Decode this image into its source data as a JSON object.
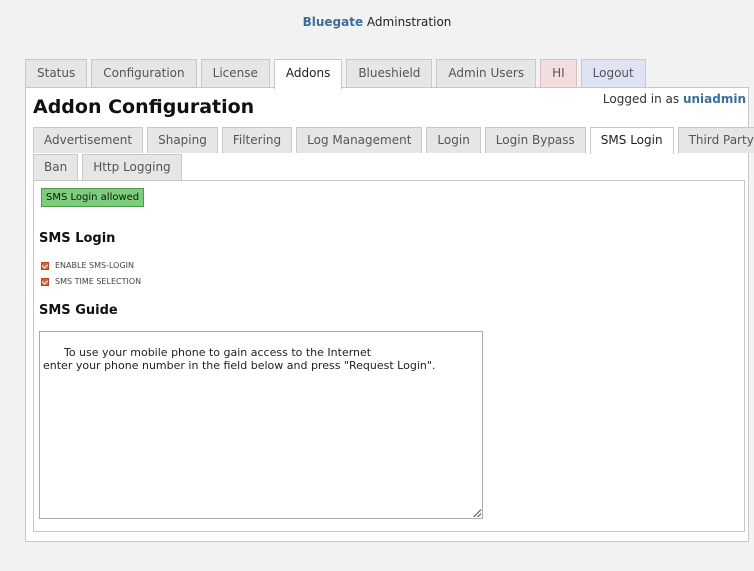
{
  "header": {
    "brand": "Bluegate",
    "title_rest": " Adminstration"
  },
  "main_tabs": [
    {
      "label": "Status"
    },
    {
      "label": "Configuration"
    },
    {
      "label": "License"
    },
    {
      "label": "Addons"
    },
    {
      "label": "Blueshield"
    },
    {
      "label": "Admin Users"
    },
    {
      "label": "HI"
    },
    {
      "label": "Logout"
    }
  ],
  "session": {
    "prefix": "Logged in as ",
    "user": "uniadmin"
  },
  "page_title": "Addon Configuration",
  "sub_tabs": [
    {
      "label": "Advertisement"
    },
    {
      "label": "Shaping"
    },
    {
      "label": "Filtering"
    },
    {
      "label": "Log Management"
    },
    {
      "label": "Login"
    },
    {
      "label": "Login Bypass"
    },
    {
      "label": "SMS Login"
    },
    {
      "label": "Third Party"
    },
    {
      "label": "Ban"
    },
    {
      "label": "Http Logging"
    }
  ],
  "status_badge": "SMS Login allowed",
  "sms_login": {
    "title": "SMS Login",
    "options": [
      {
        "label": "ENABLE SMS-LOGIN",
        "checked": true
      },
      {
        "label": "SMS TIME SELECTION",
        "checked": true
      }
    ]
  },
  "sms_guide": {
    "title": "SMS Guide",
    "text": "To use your mobile phone to gain access to the Internet\nenter your phone number in the field below and press \"Request Login\"."
  },
  "colors": {
    "brand": "#3b6e9c",
    "status_badge_bg": "#7ccd7c",
    "hi_tab_bg": "#f2dede",
    "logout_tab_bg": "#dfe3f3",
    "checkbox": "#d9633b"
  }
}
